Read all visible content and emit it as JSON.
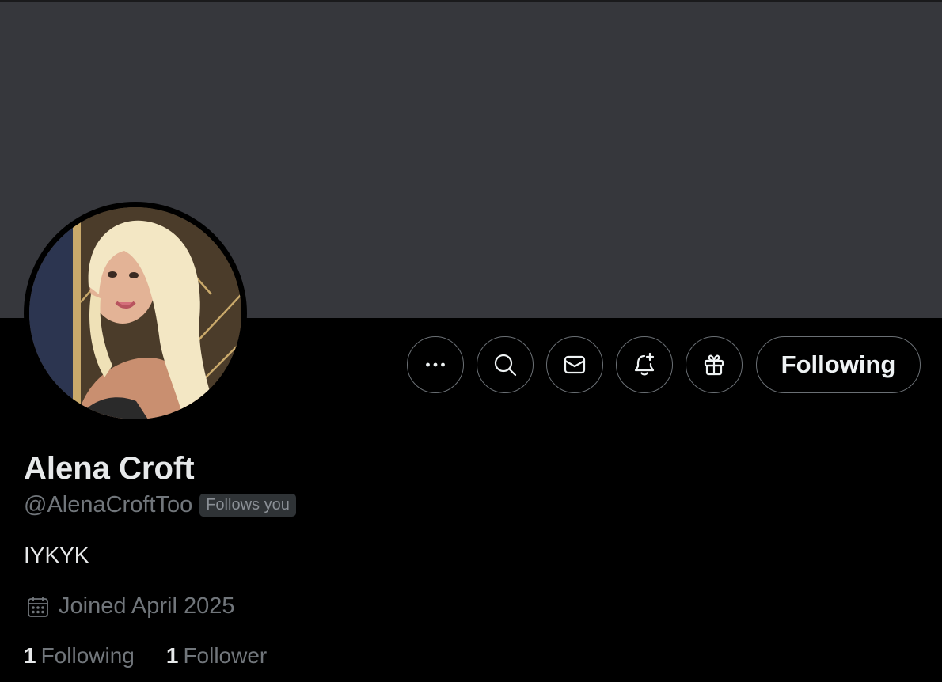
{
  "profile": {
    "display_name": "Alena Croft",
    "handle": "@AlenaCroftToo",
    "follows_you_badge": "Follows you",
    "bio": "IYKYK",
    "joined": "Joined April 2025",
    "following_count": "1",
    "following_label": "Following",
    "followers_count": "1",
    "followers_label": "Follower"
  },
  "actions": {
    "more_icon": "more-horizontal-icon",
    "search_icon": "search-icon",
    "message_icon": "envelope-icon",
    "notify_icon": "bell-plus-icon",
    "gift_icon": "gift-icon",
    "follow_button_label": "Following"
  },
  "colors": {
    "banner": "#36373c",
    "background": "#000000",
    "primary_text": "#e7e9ea",
    "secondary_text": "#71767b",
    "badge_bg": "#2f3336"
  }
}
